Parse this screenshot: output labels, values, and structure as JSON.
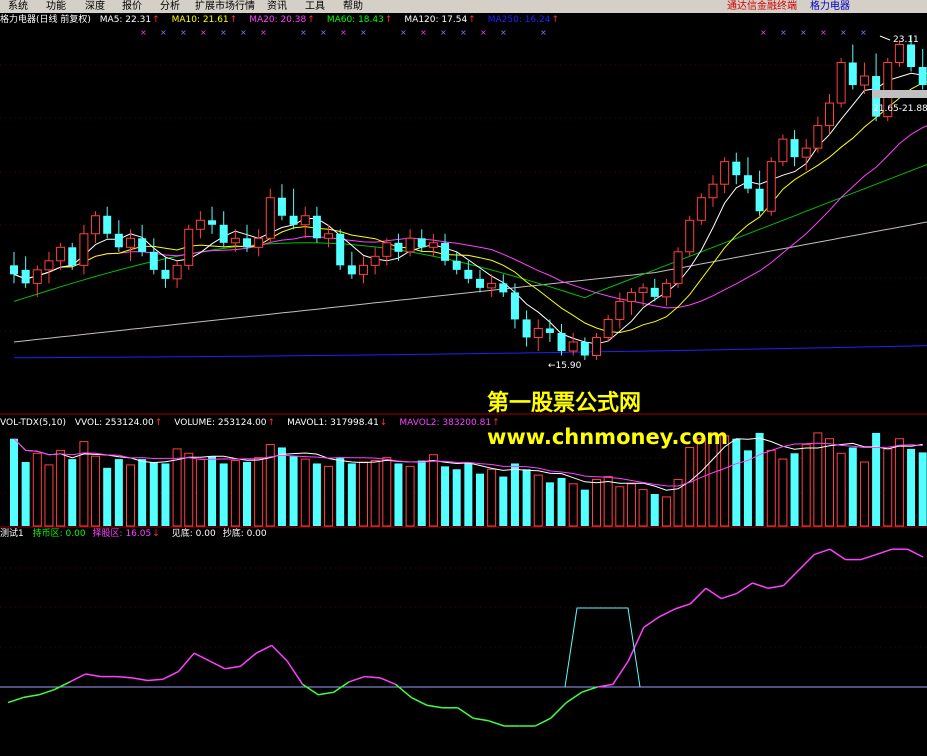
{
  "menu": [
    {
      "label": "系统",
      "name": "menu-system"
    },
    {
      "label": "功能",
      "name": "menu-function"
    },
    {
      "label": "深度",
      "name": "menu-depth"
    },
    {
      "label": "报价",
      "name": "menu-quote"
    },
    {
      "label": "分析",
      "name": "menu-analysis"
    },
    {
      "label": "扩展市场行情",
      "name": "menu-ext-market"
    },
    {
      "label": "资讯",
      "name": "menu-news"
    },
    {
      "label": "工具",
      "name": "menu-tools"
    },
    {
      "label": "帮助",
      "name": "menu-help"
    }
  ],
  "brand": "通达信金融终端",
  "stock_name": "格力电器",
  "price_panel": {
    "title": "格力电器(日线 前复权)",
    "items": [
      {
        "label": "MA5: 22.31",
        "color": "#ffffff",
        "arrow": "↑"
      },
      {
        "label": "MA10: 21.61",
        "color": "#ffff00",
        "arrow": "↑"
      },
      {
        "label": "MA20: 20.38",
        "color": "#ff40ff",
        "arrow": "↑"
      },
      {
        "label": "MA60: 18.43",
        "color": "#00ff00",
        "arrow": "↑"
      },
      {
        "label": "MA120: 17.54",
        "color": "#ffffff",
        "arrow": "↑"
      },
      {
        "label": "MA250: 16.24",
        "color": "#2020ff",
        "arrow": "↑"
      }
    ],
    "high_label": "23.11",
    "low_label": "←15.90",
    "range_label": "21.65-21.88"
  },
  "volume_panel": {
    "title": "VOL-TDX(5,10)",
    "items": [
      {
        "label": "VVOL: 253124.00",
        "color": "#ffffff",
        "arrow": "↑"
      },
      {
        "label": "VOLUME: 253124.00",
        "color": "#ffffff",
        "arrow": "↑"
      },
      {
        "label": "MAVOL1: 317998.41",
        "color": "#ffffff",
        "arrow": "↓"
      },
      {
        "label": "MAVOL2: 383200.81",
        "color": "#ff40ff",
        "arrow": "↑"
      }
    ]
  },
  "indicator_panel": {
    "title": "测试1",
    "items": [
      {
        "label": "持币区: 0.00",
        "color": "#00ff00",
        "arrow": ""
      },
      {
        "label": "择股区: 16.05",
        "color": "#ff40ff",
        "arrow": "↓"
      },
      {
        "label": "见底: 0.00",
        "color": "#ffffff",
        "arrow": ""
      },
      {
        "label": "抄底: 0.00",
        "color": "#ffffff",
        "arrow": ""
      }
    ]
  },
  "watermark": {
    "line1": "第一股票公式网",
    "line2": "www.chnmoney.com"
  },
  "colors": {
    "up": "#ff4040",
    "down": "#54ffff",
    "ma5": "#ffffff",
    "ma10": "#ffff00",
    "ma20": "#ff40ff",
    "ma60": "#00c000",
    "ma120": "#c0c0c0",
    "ma250": "#2020ff"
  },
  "chart_data": {
    "type": "candlestick",
    "candles": [
      {
        "o": 18.0,
        "h": 18.3,
        "l": 17.6,
        "c": 17.8
      },
      {
        "o": 17.9,
        "h": 18.2,
        "l": 17.5,
        "c": 17.6
      },
      {
        "o": 17.6,
        "h": 18.0,
        "l": 17.3,
        "c": 17.9
      },
      {
        "o": 17.9,
        "h": 18.3,
        "l": 17.6,
        "c": 18.1
      },
      {
        "o": 18.1,
        "h": 18.5,
        "l": 17.9,
        "c": 18.4
      },
      {
        "o": 18.4,
        "h": 18.5,
        "l": 17.9,
        "c": 18.0
      },
      {
        "o": 18.0,
        "h": 18.9,
        "l": 17.8,
        "c": 18.7
      },
      {
        "o": 18.7,
        "h": 19.2,
        "l": 18.5,
        "c": 19.1
      },
      {
        "o": 19.1,
        "h": 19.3,
        "l": 18.6,
        "c": 18.7
      },
      {
        "o": 18.7,
        "h": 19.0,
        "l": 18.3,
        "c": 18.4
      },
      {
        "o": 18.4,
        "h": 18.8,
        "l": 18.1,
        "c": 18.6
      },
      {
        "o": 18.6,
        "h": 18.9,
        "l": 18.2,
        "c": 18.3
      },
      {
        "o": 18.3,
        "h": 18.6,
        "l": 17.8,
        "c": 17.9
      },
      {
        "o": 17.9,
        "h": 18.2,
        "l": 17.5,
        "c": 17.7
      },
      {
        "o": 17.7,
        "h": 18.1,
        "l": 17.5,
        "c": 18.0
      },
      {
        "o": 18.0,
        "h": 18.9,
        "l": 17.9,
        "c": 18.8
      },
      {
        "o": 18.8,
        "h": 19.2,
        "l": 18.6,
        "c": 19.0
      },
      {
        "o": 19.0,
        "h": 19.3,
        "l": 18.7,
        "c": 18.9
      },
      {
        "o": 18.9,
        "h": 19.2,
        "l": 18.4,
        "c": 18.5
      },
      {
        "o": 18.5,
        "h": 18.8,
        "l": 18.3,
        "c": 18.6
      },
      {
        "o": 18.6,
        "h": 18.9,
        "l": 18.3,
        "c": 18.4
      },
      {
        "o": 18.4,
        "h": 18.8,
        "l": 18.2,
        "c": 18.6
      },
      {
        "o": 18.6,
        "h": 19.7,
        "l": 18.5,
        "c": 19.5
      },
      {
        "o": 19.5,
        "h": 19.8,
        "l": 19.0,
        "c": 19.1
      },
      {
        "o": 19.1,
        "h": 19.7,
        "l": 18.8,
        "c": 18.9
      },
      {
        "o": 18.9,
        "h": 19.3,
        "l": 18.6,
        "c": 19.1
      },
      {
        "o": 19.1,
        "h": 19.3,
        "l": 18.5,
        "c": 18.6
      },
      {
        "o": 18.6,
        "h": 18.9,
        "l": 18.4,
        "c": 18.7
      },
      {
        "o": 18.7,
        "h": 18.8,
        "l": 17.9,
        "c": 18.0
      },
      {
        "o": 18.0,
        "h": 18.3,
        "l": 17.7,
        "c": 17.8
      },
      {
        "o": 17.8,
        "h": 18.2,
        "l": 17.6,
        "c": 18.0
      },
      {
        "o": 18.0,
        "h": 18.4,
        "l": 17.8,
        "c": 18.2
      },
      {
        "o": 18.2,
        "h": 18.6,
        "l": 18.0,
        "c": 18.5
      },
      {
        "o": 18.5,
        "h": 18.7,
        "l": 18.1,
        "c": 18.3
      },
      {
        "o": 18.3,
        "h": 18.8,
        "l": 18.2,
        "c": 18.6
      },
      {
        "o": 18.6,
        "h": 18.8,
        "l": 18.3,
        "c": 18.4
      },
      {
        "o": 18.4,
        "h": 18.7,
        "l": 18.2,
        "c": 18.5
      },
      {
        "o": 18.5,
        "h": 18.7,
        "l": 18.0,
        "c": 18.1
      },
      {
        "o": 18.1,
        "h": 18.3,
        "l": 17.8,
        "c": 17.9
      },
      {
        "o": 17.9,
        "h": 18.1,
        "l": 17.6,
        "c": 17.7
      },
      {
        "o": 17.7,
        "h": 17.9,
        "l": 17.4,
        "c": 17.5
      },
      {
        "o": 17.5,
        "h": 17.8,
        "l": 17.3,
        "c": 17.6
      },
      {
        "o": 17.6,
        "h": 17.8,
        "l": 17.3,
        "c": 17.4
      },
      {
        "o": 17.4,
        "h": 17.6,
        "l": 16.6,
        "c": 16.8
      },
      {
        "o": 16.8,
        "h": 17.0,
        "l": 16.2,
        "c": 16.4
      },
      {
        "o": 16.4,
        "h": 16.8,
        "l": 16.1,
        "c": 16.6
      },
      {
        "o": 16.6,
        "h": 16.8,
        "l": 16.3,
        "c": 16.5
      },
      {
        "o": 16.5,
        "h": 16.7,
        "l": 16.0,
        "c": 16.1
      },
      {
        "o": 16.1,
        "h": 16.5,
        "l": 16.0,
        "c": 16.3
      },
      {
        "o": 16.3,
        "h": 16.4,
        "l": 15.9,
        "c": 16.0
      },
      {
        "o": 16.0,
        "h": 16.5,
        "l": 15.9,
        "c": 16.4
      },
      {
        "o": 16.4,
        "h": 16.9,
        "l": 16.3,
        "c": 16.8
      },
      {
        "o": 16.8,
        "h": 17.4,
        "l": 16.6,
        "c": 17.2
      },
      {
        "o": 17.2,
        "h": 17.5,
        "l": 16.9,
        "c": 17.4
      },
      {
        "o": 17.4,
        "h": 17.6,
        "l": 17.1,
        "c": 17.5
      },
      {
        "o": 17.5,
        "h": 17.7,
        "l": 17.2,
        "c": 17.3
      },
      {
        "o": 17.3,
        "h": 17.7,
        "l": 17.1,
        "c": 17.6
      },
      {
        "o": 17.6,
        "h": 18.4,
        "l": 17.5,
        "c": 18.3
      },
      {
        "o": 18.3,
        "h": 19.1,
        "l": 18.2,
        "c": 19.0
      },
      {
        "o": 19.0,
        "h": 19.6,
        "l": 18.9,
        "c": 19.5
      },
      {
        "o": 19.5,
        "h": 20.0,
        "l": 19.3,
        "c": 19.8
      },
      {
        "o": 19.8,
        "h": 20.4,
        "l": 19.6,
        "c": 20.3
      },
      {
        "o": 20.3,
        "h": 20.5,
        "l": 19.8,
        "c": 20.0
      },
      {
        "o": 20.0,
        "h": 20.4,
        "l": 19.6,
        "c": 19.7
      },
      {
        "o": 19.7,
        "h": 20.1,
        "l": 19.1,
        "c": 19.2
      },
      {
        "o": 19.2,
        "h": 20.4,
        "l": 19.1,
        "c": 20.3
      },
      {
        "o": 20.3,
        "h": 20.9,
        "l": 20.2,
        "c": 20.8
      },
      {
        "o": 20.8,
        "h": 21.0,
        "l": 20.2,
        "c": 20.4
      },
      {
        "o": 20.4,
        "h": 20.8,
        "l": 20.1,
        "c": 20.6
      },
      {
        "o": 20.6,
        "h": 21.3,
        "l": 20.5,
        "c": 21.1
      },
      {
        "o": 21.1,
        "h": 21.8,
        "l": 20.9,
        "c": 21.6
      },
      {
        "o": 21.6,
        "h": 22.6,
        "l": 21.5,
        "c": 22.5
      },
      {
        "o": 22.5,
        "h": 22.9,
        "l": 21.9,
        "c": 22.0
      },
      {
        "o": 22.0,
        "h": 22.5,
        "l": 21.8,
        "c": 22.2
      },
      {
        "o": 22.2,
        "h": 22.7,
        "l": 21.2,
        "c": 21.3
      },
      {
        "o": 21.3,
        "h": 22.6,
        "l": 21.2,
        "c": 22.5
      },
      {
        "o": 22.5,
        "h": 23.0,
        "l": 22.4,
        "c": 22.9
      },
      {
        "o": 22.9,
        "h": 23.11,
        "l": 22.3,
        "c": 22.4
      },
      {
        "o": 22.4,
        "h": 22.8,
        "l": 21.9,
        "c": 22.0
      },
      {
        "o": 22.0,
        "h": 22.3,
        "l": 21.65,
        "c": 21.88
      }
    ],
    "volume": [
      300,
      220,
      250,
      210,
      260,
      230,
      290,
      240,
      200,
      230,
      210,
      230,
      220,
      215,
      265,
      250,
      230,
      240,
      215,
      225,
      220,
      235,
      280,
      270,
      240,
      230,
      215,
      205,
      235,
      215,
      220,
      225,
      235,
      215,
      205,
      225,
      245,
      205,
      195,
      215,
      180,
      195,
      170,
      215,
      195,
      175,
      150,
      165,
      145,
      125,
      160,
      170,
      135,
      145,
      125,
      110,
      100,
      160,
      270,
      300,
      320,
      310,
      300,
      260,
      320,
      260,
      230,
      250,
      280,
      320,
      300,
      250,
      270,
      220,
      320,
      265,
      300,
      265,
      253
    ],
    "indicator": [
      -0.6,
      -0.4,
      -0.3,
      -0.1,
      0.2,
      0.5,
      0.4,
      0.4,
      0.35,
      0.25,
      0.3,
      0.6,
      1.3,
      1.0,
      0.7,
      0.8,
      1.3,
      1.6,
      1.0,
      0.1,
      -0.3,
      -0.2,
      0.2,
      0.4,
      0.35,
      0.1,
      -0.4,
      -0.7,
      -0.8,
      -0.8,
      -1.2,
      -1.3,
      -1.5,
      -1.5,
      -1.5,
      -1.2,
      -0.6,
      -0.2,
      0.0,
      0.1,
      1.0,
      2.3,
      2.7,
      3.0,
      3.2,
      3.8,
      3.4,
      3.6,
      4.0,
      3.8,
      3.9,
      4.5,
      5.1,
      5.3,
      4.9,
      4.9,
      5.1,
      5.3,
      5.3,
      5.0
    ]
  }
}
